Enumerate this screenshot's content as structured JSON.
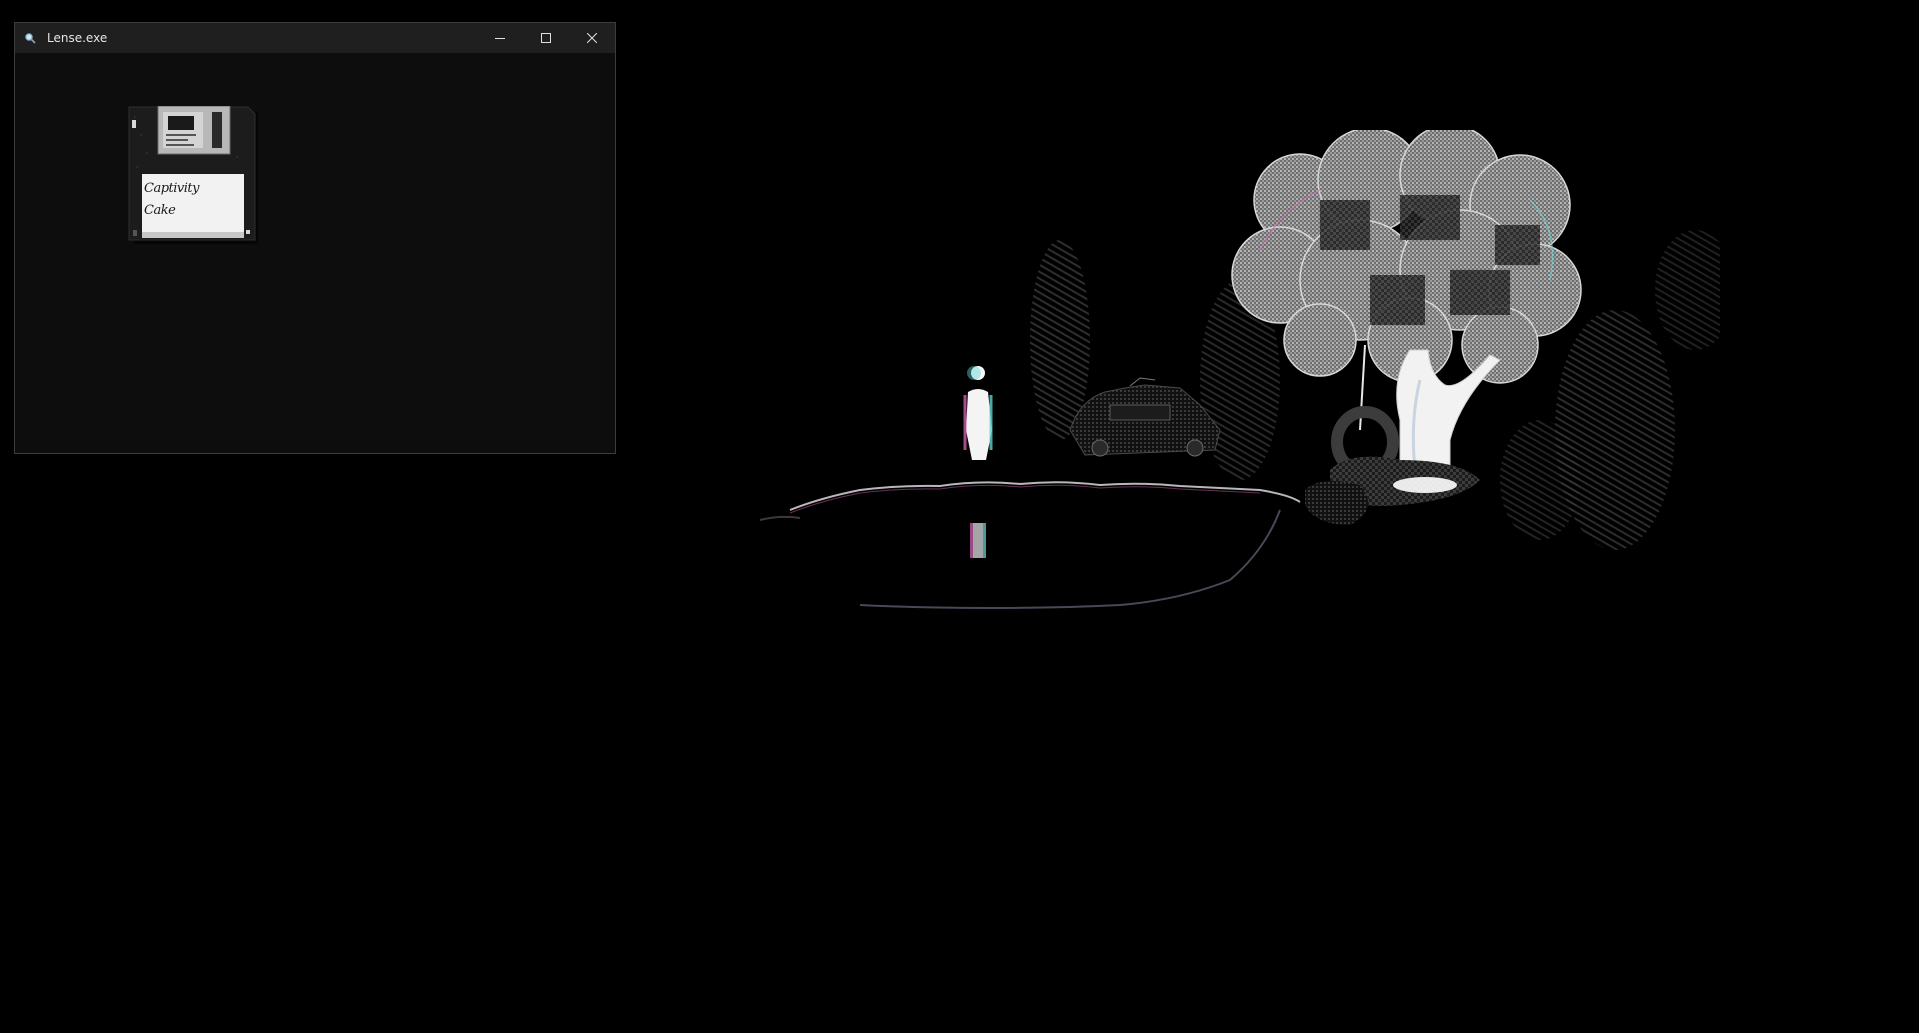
{
  "window": {
    "title": "Lense.exe",
    "icon": "magnifier-icon",
    "controls": {
      "minimize": "minimize-icon",
      "maximize": "maximize-icon",
      "close": "close-icon"
    }
  },
  "floppy": {
    "label_lines": "Captivity\nCake",
    "colors": {
      "body": "#1c1c1c",
      "shutter": "#bdbdbd",
      "label": "#f2f2f2"
    }
  },
  "scene": {
    "elements": [
      "glowing-figure",
      "figure-reflection",
      "shoreline",
      "crashed-car",
      "tree-with-tire-swing",
      "dark-foliage"
    ],
    "colors": {
      "background": "#000000",
      "figure": "#f4f4f4",
      "accent_magenta": "#d060b0",
      "accent_cyan": "#60d0d0",
      "foliage": "#3a3a3a",
      "canopy": "#8c8c8c"
    }
  }
}
